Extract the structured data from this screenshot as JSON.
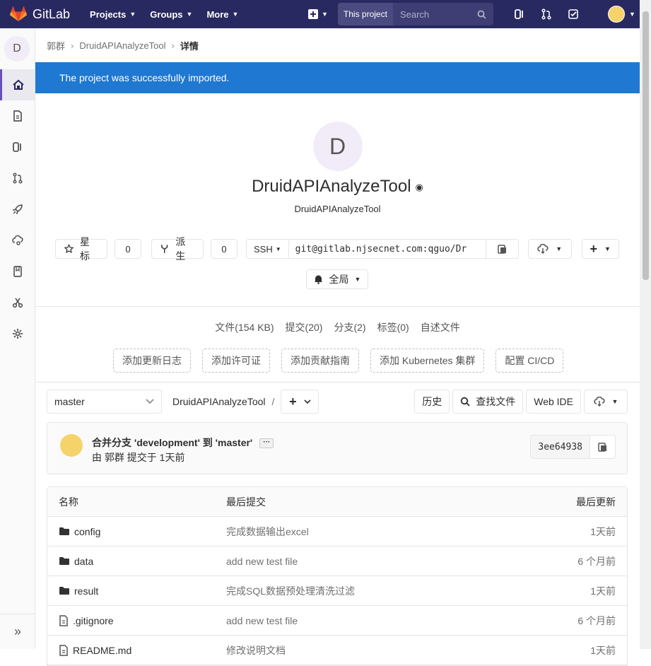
{
  "nav": {
    "brand": "GitLab",
    "menu": [
      {
        "label": "Projects"
      },
      {
        "label": "Groups"
      },
      {
        "label": "More"
      }
    ],
    "search_scope": "This project",
    "search_placeholder": "Search"
  },
  "breadcrumb": {
    "group": "郭群",
    "project": "DruidAPIAnalyzeTool",
    "current": "详情"
  },
  "sidebar": {
    "avatar_letter": "D",
    "items": [
      "project-overview",
      "repository",
      "issues",
      "merge-requests",
      "ci-cd",
      "operations",
      "wiki",
      "snippets",
      "settings"
    ]
  },
  "flash": "The project was successfully imported.",
  "project": {
    "avatar_letter": "D",
    "name": "DruidAPIAnalyzeTool",
    "description": "DruidAPIAnalyzeTool"
  },
  "actions": {
    "star_label": "星标",
    "star_count": "0",
    "fork_label": "派生",
    "fork_count": "0",
    "clone_protocol": "SSH",
    "clone_url": "git@gitlab.njsecnet.com:qguo/Dr",
    "notification_label": "全局"
  },
  "stats": {
    "files": "文件(154 KB)",
    "commits": "提交(20)",
    "branches": "分支(2)",
    "tags": "标签(0)",
    "readme": "自述文件"
  },
  "quick_buttons": [
    "添加更新日志",
    "添加许可证",
    "添加贡献指南",
    "添加 Kubernetes 集群",
    "配置 CI/CD"
  ],
  "tree": {
    "branch": "master",
    "path": "DruidAPIAnalyzeTool",
    "path_sep": "/",
    "history": "历史",
    "find_file": "查找文件",
    "web_ide": "Web IDE"
  },
  "commit": {
    "title": "合并分支 'development' 到 'master'",
    "more": "···",
    "meta": "由 郭群 提交于 1天前",
    "sha": "3ee64938"
  },
  "table": {
    "headers": {
      "name": "名称",
      "last_commit": "最后提交",
      "last_update": "最后更新"
    },
    "rows": [
      {
        "name": "config",
        "type": "folder",
        "commit": "完成数据输出excel",
        "updated": "1天前"
      },
      {
        "name": "data",
        "type": "folder",
        "commit": "add new test file",
        "updated": "6 个月前"
      },
      {
        "name": "result",
        "type": "folder",
        "commit": "完成SQL数据预处理清洗过滤",
        "updated": "1天前"
      },
      {
        "name": ".gitignore",
        "type": "file",
        "commit": "add new test file",
        "updated": "6 个月前"
      },
      {
        "name": "README.md",
        "type": "file",
        "commit": "修改说明文档",
        "updated": "1天前"
      }
    ]
  }
}
